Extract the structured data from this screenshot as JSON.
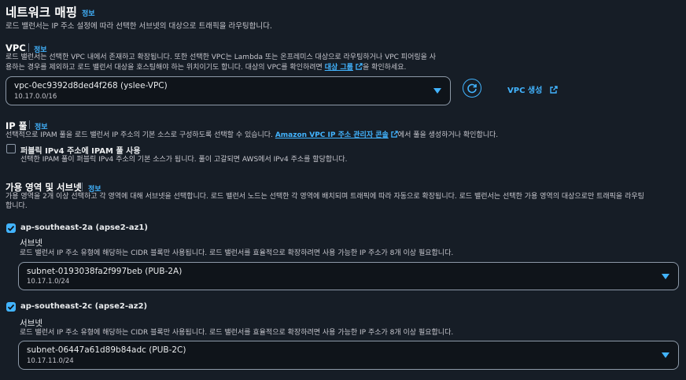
{
  "section": {
    "title": "네트워크 매핑",
    "info": "정보",
    "description": "로드 밸런서는 IP 주소 설정에 따라 선택한 서브넷의 대상으로 트래픽을 라우팅합니다."
  },
  "vpc": {
    "label": "VPC",
    "info": "정보",
    "desc_line1": "로드 밸런서는 선택한 VPC 내에서 존재하고 확장됩니다. 또한 선택한 VPC는 Lambda 또는 온프레미스 대상으로 라우팅하거나 VPC 피어링을 사",
    "desc_line2_pre": "용하는 경우를 제외하고 로드 밸런서 대상을 호스팅해야 하는 위치이기도 합니다. 대상의 VPC를 확인하려면 ",
    "desc_link": "대상 그룹",
    "desc_line2_post": "을 확인하세요.",
    "selected": "vpc-0ec9392d8ded4f268 (yslee-VPC)",
    "cidr": "10.17.0.0/16",
    "create_link": "VPC 생성"
  },
  "ip_pool": {
    "label": "IP 풀",
    "info": "정보",
    "desc_pre": "선택적으로 IPAM 풀을 로드 밸런서 IP 주소의 기본 소스로 구성하도록 선택할 수 있습니다. ",
    "desc_link": "Amazon VPC IP 주소 관리자 콘솔",
    "desc_post": "에서 풀을 생성하거나 확인합니다.",
    "checkbox_label": "퍼블릭 IPv4 주소에 IPAM 풀 사용",
    "checkbox_desc": "선택한 IPAM 풀이 퍼블릭 IPv4 주소의 기본 소스가 됩니다. 풀이 고갈되면 AWS에서 IPv4 주소를 할당합니다.",
    "checked": false
  },
  "az": {
    "label": "가용 영역 및 서브넷",
    "info": "정보",
    "desc_line1": "가용 영역을 2개 이상 선택하고 각 영역에 대해 서브넷을 선택합니다. 로드 밸런서 노드는 선택한 각 영역에 배치되며 트래픽에 따라 자동으로 확장됩니다. 로드 밸런서는 선택한 가용 영역의 대상으로만 트래픽을 라우팅",
    "desc_line2": "합니다.",
    "zones": [
      {
        "name": "ap-southeast-2a (apse2-az1)",
        "checked": true,
        "subnet_label": "서브넷",
        "subnet_desc": "로드 밸런서 IP 주소 유형에 해당하는 CIDR 블록만 사용됩니다. 로드 밸런서를 효율적으로 확장하려면 사용 가능한 IP 주소가 8개 이상 필요합니다.",
        "subnet_value": "subnet-0193038fa2f997beb (PUB-2A)",
        "subnet_cidr": "10.17.1.0/24"
      },
      {
        "name": "ap-southeast-2c (apse2-az2)",
        "checked": true,
        "subnet_label": "서브넷",
        "subnet_desc": "로드 밸런서 IP 주소 유형에 해당하는 CIDR 블록만 사용됩니다. 로드 밸런서를 효율적으로 확장하려면 사용 가능한 IP 주소가 8개 이상 필요합니다.",
        "subnet_value": "subnet-06447a61d89b84adc (PUB-2C)",
        "subnet_cidr": "10.17.11.0/24"
      }
    ]
  },
  "colors": {
    "background": "#161d26",
    "accent": "#42b4ff",
    "input_border": "#8d99a8"
  }
}
